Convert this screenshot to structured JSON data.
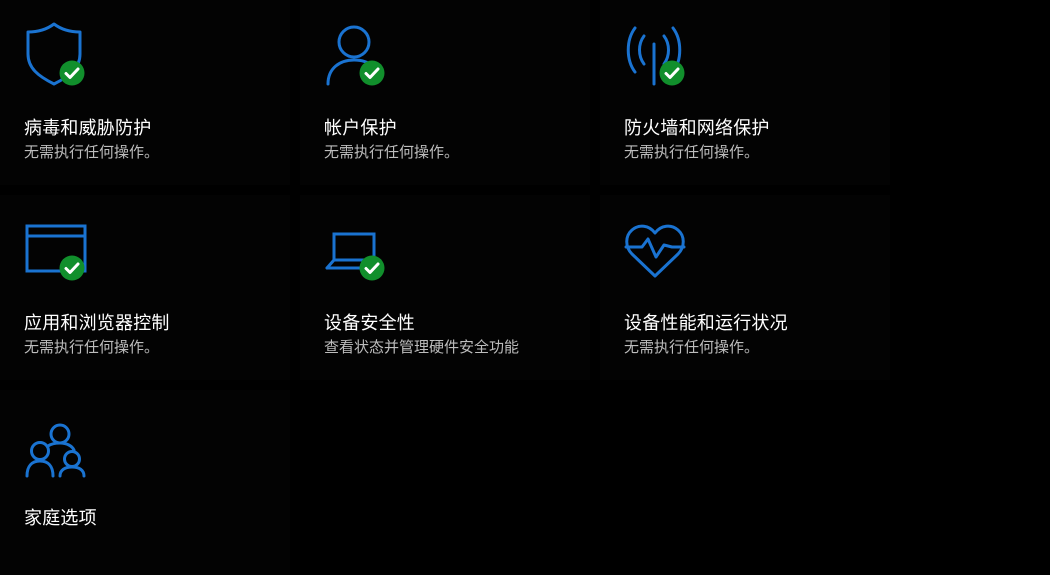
{
  "colors": {
    "accent": "#1a73d1",
    "status_ok": "#118f2c",
    "background": "#000000",
    "tile": "#030303",
    "title_text": "#ffffff",
    "desc_text": "#bdbdbd"
  },
  "tiles": [
    {
      "title": "病毒和威胁防护",
      "desc": "无需执行任何操作。",
      "icon": "shield-icon",
      "status": "ok"
    },
    {
      "title": "帐户保护",
      "desc": "无需执行任何操作。",
      "icon": "person-icon",
      "status": "ok"
    },
    {
      "title": "防火墙和网络保护",
      "desc": "无需执行任何操作。",
      "icon": "antenna-icon",
      "status": "ok"
    },
    {
      "title": "应用和浏览器控制",
      "desc": "无需执行任何操作。",
      "icon": "browser-window-icon",
      "status": "ok"
    },
    {
      "title": "设备安全性",
      "desc": "查看状态并管理硬件安全功能",
      "icon": "laptop-icon",
      "status": "ok"
    },
    {
      "title": "设备性能和运行状况",
      "desc": "无需执行任何操作。",
      "icon": "heart-pulse-icon",
      "status": "none"
    },
    {
      "title": "家庭选项",
      "desc": "",
      "icon": "family-icon",
      "status": "none"
    }
  ]
}
